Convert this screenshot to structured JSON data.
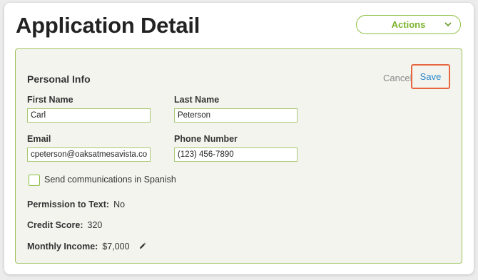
{
  "page": {
    "title": "Application Detail"
  },
  "actions": {
    "label": "Actions",
    "icon": "chevron-down-icon"
  },
  "personal_info": {
    "title": "Personal Info",
    "cancel_label": "Cancel",
    "save_label": "Save",
    "fields": {
      "first_name": {
        "label": "First Name",
        "value": "Carl"
      },
      "last_name": {
        "label": "Last Name",
        "value": "Peterson"
      },
      "email": {
        "label": "Email",
        "value": "cpeterson@oaksatmesavista.com"
      },
      "phone": {
        "label": "Phone Number",
        "value": "(123) 456-7890"
      }
    },
    "spanish_checkbox": {
      "label": "Send communications in Spanish",
      "checked": false
    },
    "permission_to_text": {
      "label": "Permission to Text:",
      "value": "No"
    },
    "credit_score": {
      "label": "Credit Score:",
      "value": "320"
    },
    "monthly_income": {
      "label": "Monthly Income:",
      "value": "$7,000",
      "icon": "pencil-icon"
    }
  },
  "colors": {
    "accent_green": "#8cbf3f",
    "link_blue": "#2b88c8",
    "highlight_orange": "#e8663d",
    "panel_bg": "#f4f4ef"
  }
}
